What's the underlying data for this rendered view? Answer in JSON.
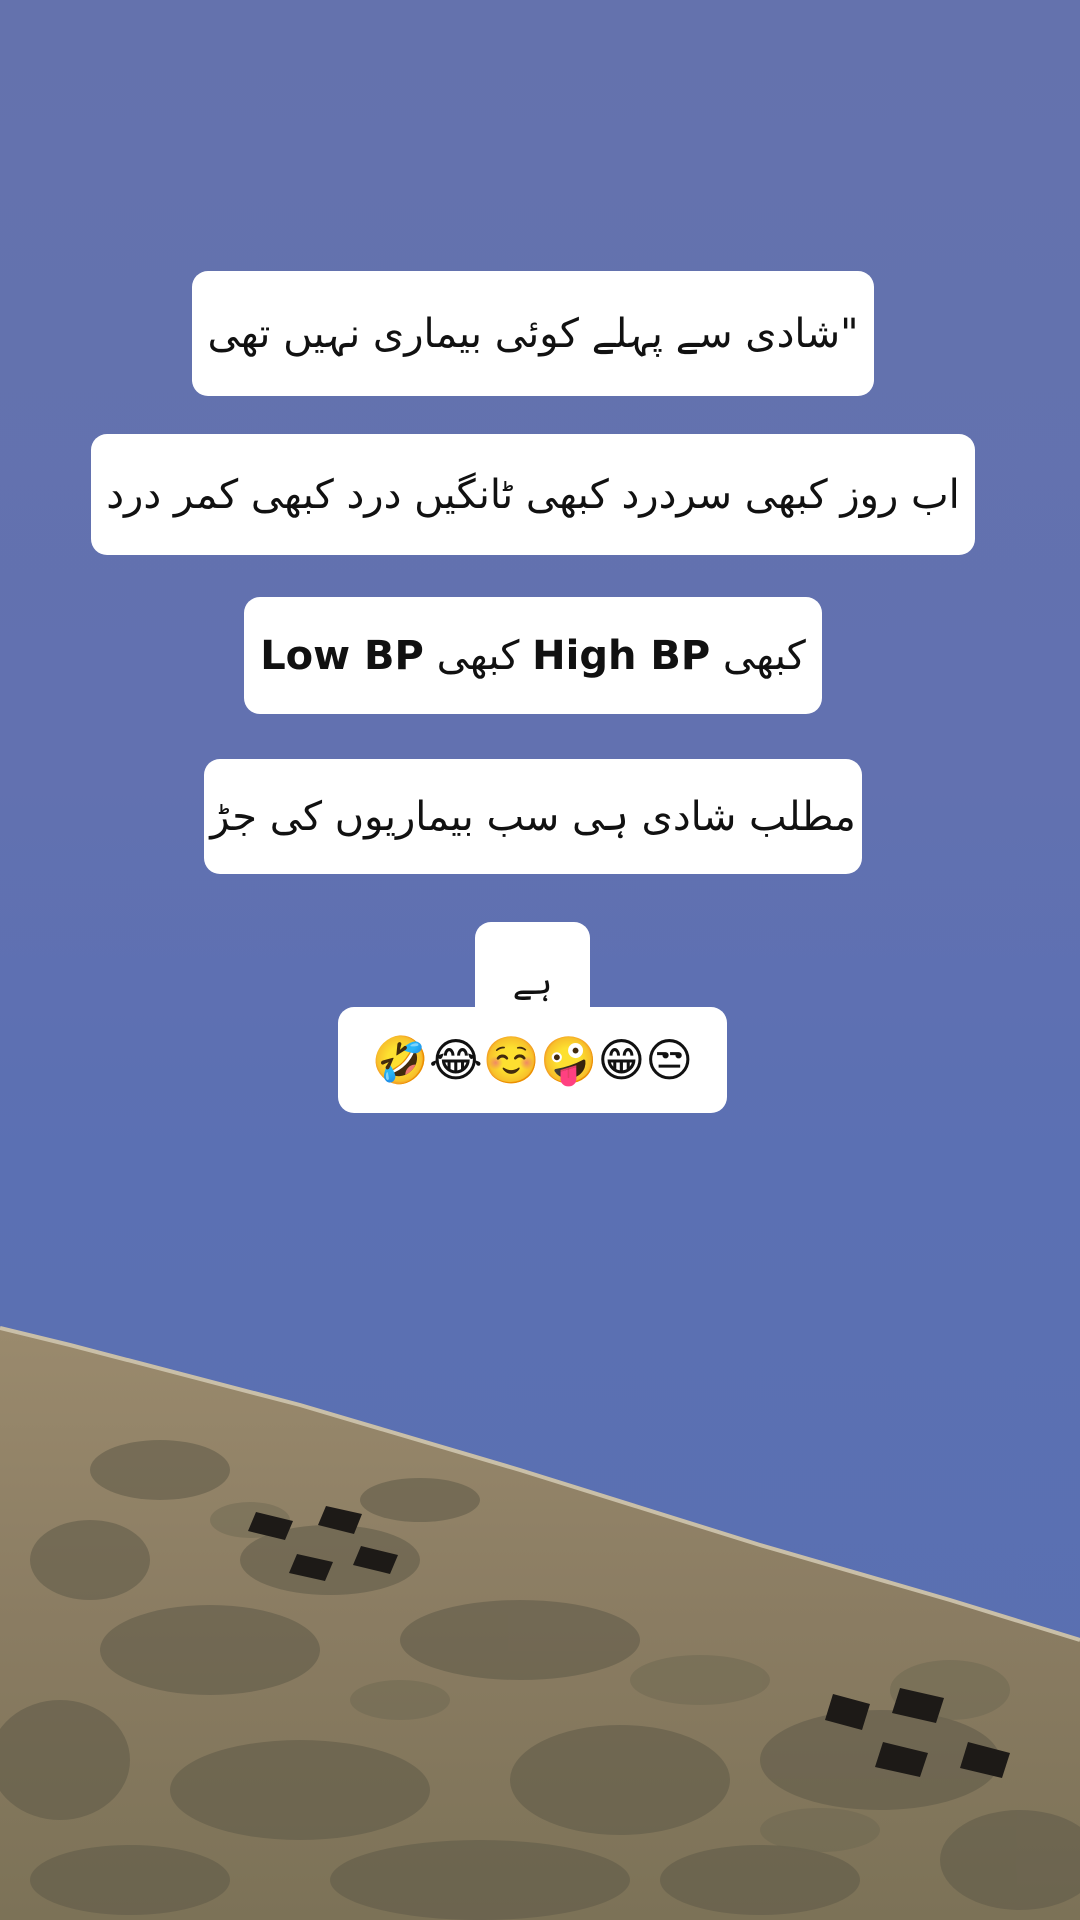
{
  "lines": {
    "line1": "\"شادی سے پہلے کوئی بیماری نہیں تھی",
    "line2": "اب روز کبھی سردرد کبھی ٹانگیں درد کبھی کمر درد",
    "line3_part1": "کبھی",
    "line3_part2": "High BP",
    "line3_part3": "کبھی",
    "line3_part4": "Low BP",
    "line4": "مطلب شادی ہی سب بیماریوں کی جڑ",
    "line5": "ہے",
    "emojis": "🤣😂☺️🤪😁😒"
  },
  "colors": {
    "sky": "#6472ad",
    "wall": "#8d7d62",
    "bubble": "#ffffff",
    "text": "#111111"
  }
}
